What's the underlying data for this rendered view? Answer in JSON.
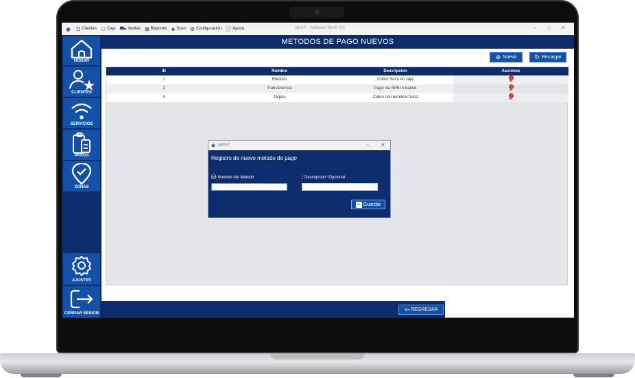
{
  "menubar": {
    "items": [
      {
        "icon": "people-icon",
        "label": "Clientes"
      },
      {
        "icon": "cash-icon",
        "label": "Caja"
      },
      {
        "icon": "cart-icon",
        "label": "Ventas"
      },
      {
        "icon": "report-icon",
        "label": "Reportes"
      },
      {
        "icon": "scan-icon",
        "label": "Scan"
      },
      {
        "icon": "gear-icon",
        "label": "Configuración"
      },
      {
        "icon": "help-icon",
        "label": "Ayuda"
      }
    ],
    "window_title": "iWISP - Software WISP 2.0"
  },
  "sidebar": {
    "hogar": "HOGAR",
    "clientes": "CLIENTES",
    "servicios": "SERVICIOS",
    "pagos": "PAGOS",
    "zonas": "ZONAS",
    "ajustes": "AJUSTES",
    "cerrar": "CERRAR SESION"
  },
  "main": {
    "title": "METODOS DE PAGO NUEVOS",
    "nuevo_label": "Nuevo",
    "recargar_label": "Recargar",
    "regresar_label": "REGRESAR"
  },
  "table": {
    "headers": {
      "id": "ID",
      "nombre": "Nombre",
      "descripcion": "Descripcion",
      "acciones": "Acciones"
    },
    "rows": [
      {
        "id": "1",
        "nombre": "Efectivo",
        "descripcion": "Cobro fisico en caja"
      },
      {
        "id": "2",
        "nombre": "Transferencia",
        "descripcion": "Pago via SPEI o banco"
      },
      {
        "id": "3",
        "nombre": "Tarjeta",
        "descripcion": "Cobro con terminal fisica"
      }
    ],
    "action_colors": {
      "edit": "#2f3ea8",
      "user": "#4caf50",
      "delete": "#e53935"
    }
  },
  "dialog": {
    "app": "iWISP",
    "heading": "Registro de nuevo metodo de pago",
    "nombre_label": "Nombre del Metodo",
    "descripcion_label": "Descripcion *Opcional",
    "nombre_value": "",
    "descripcion_value": "",
    "guardar_label": "Guardar"
  }
}
